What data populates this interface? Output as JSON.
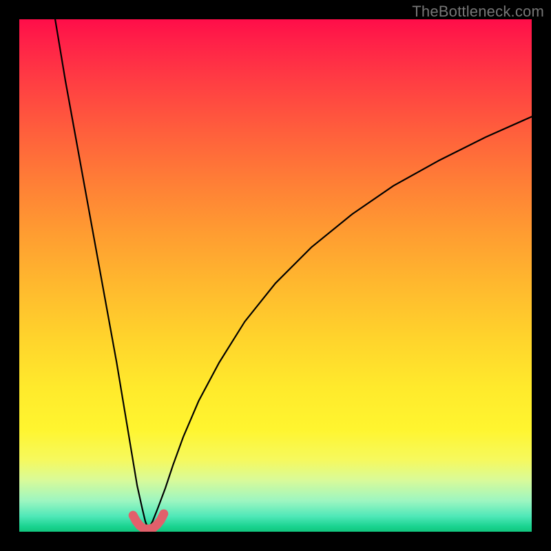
{
  "watermark": "TheBottleneck.com",
  "chart_data": {
    "type": "line",
    "title": "",
    "xlabel": "",
    "ylabel": "",
    "xlim": [
      0,
      100
    ],
    "ylim": [
      0,
      100
    ],
    "gradient_bands_top_to_bottom": [
      "red",
      "orange",
      "yellow",
      "light-yellow",
      "green"
    ],
    "series": [
      {
        "name": "left-branch",
        "x": [
          7,
          9,
          11,
          13,
          15,
          17,
          19,
          20.5,
          22,
          23,
          24,
          24.6,
          25.2
        ],
        "y": [
          100,
          88,
          77,
          66,
          55,
          44,
          33,
          24,
          15,
          9,
          4.5,
          2,
          0.5
        ]
      },
      {
        "name": "right-branch",
        "x": [
          25.2,
          26,
          27,
          28.5,
          30,
          32,
          35,
          39,
          44,
          50,
          57,
          65,
          73,
          82,
          91,
          100
        ],
        "y": [
          0.5,
          2,
          4.5,
          8.5,
          13,
          18.5,
          25.5,
          33,
          41,
          48.5,
          55.5,
          62,
          67.5,
          72.5,
          77,
          81
        ]
      },
      {
        "name": "trough-highlight",
        "x": [
          22.2,
          22.8,
          23.5,
          24.3,
          25.2,
          26.1,
          26.9,
          27.6,
          28.2
        ],
        "y": [
          3.2,
          2.1,
          1.2,
          0.6,
          0.5,
          0.7,
          1.4,
          2.3,
          3.5
        ]
      }
    ],
    "annotations": []
  }
}
